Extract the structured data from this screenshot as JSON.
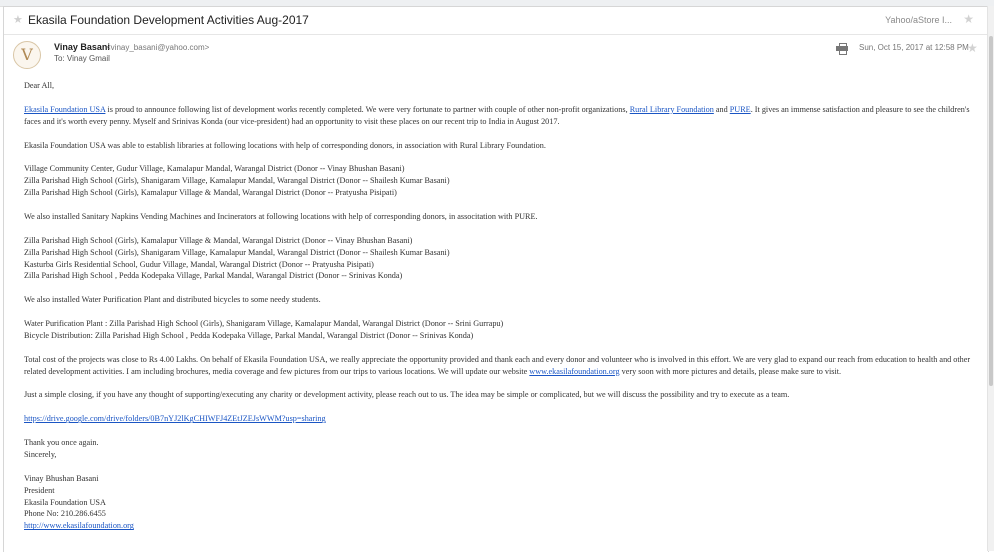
{
  "email": {
    "subject": "Ekasila Foundation Development Activities Aug-2017",
    "folder": "Yahoo/aStore I...",
    "sender_name": "Vinay Basani",
    "sender_email": "<vinay_basani@yahoo.com>",
    "to_line": "To: Vinay Gmail",
    "date": "Sun, Oct 15, 2017 at 12:58 PM",
    "avatar_letter": "V"
  },
  "body": {
    "greeting": "Dear All,",
    "p1_link1": "Ekasila Foundation USA",
    "p1_text1": " is proud to announce following list of development works recently completed. We were very fortunate to partner with couple of other non-profit organizations, ",
    "p1_link2": "Rural Library Foundation",
    "p1_text2": " and ",
    "p1_link3": "PURE",
    "p1_text3": ". It gives an immense satisfaction and pleasure to see the children's faces and it's worth every penny. Myself and Srinivas Konda (our vice-president) had an opportunity to visit these places on our recent trip to India in August 2017.",
    "p2": "Ekasila Foundation USA was able to establish libraries at following locations with help of corresponding donors, in association with Rural Library Foundation.",
    "libraries": [
      "Village Community Center, Gudur Village, Kamalapur Mandal, Warangal District (Donor -- Vinay Bhushan Basani)",
      "Zilla Parishad High School (Girls), Shanigaram Village, Kamalapur Mandal, Warangal District (Donor -- Shailesh Kumar Basani)",
      "Zilla Parishad High School (Girls), Kamalapur Village & Mandal, Warangal District (Donor -- Pratyusha Pisipati)"
    ],
    "p3": "We also installed Sanitary Napkins Vending Machines and Incinerators at following locations with help of corresponding donors, in associtation with PURE.",
    "napkins": [
      "Zilla Parishad High School (Girls), Kamalapur Village & Mandal, Warangal District (Donor -- Vinay Bhushan Basani)",
      "Zilla Parishad High School (Girls), Shanigaram Village, Kamalapur Mandal, Warangal District (Donor -- Shailesh Kumar Basani)",
      "Kasturba Girls Residential School,  Gudur Village, Mandal, Warangal District (Donor -- Pratyusha Pisipati)",
      "Zilla Parishad High School , Pedda Kodepaka Village, Parkal Mandal, Warangal District (Donor -- Srinivas Konda)"
    ],
    "p4": "We also installed Water Purification Plant and distributed bicycles to some needy students.",
    "water": [
      "Water Purification Plant : Zilla Parishad High School (Girls), Shanigaram Village, Kamalapur Mandal, Warangal District (Donor -- Srini Gurrapu)",
      "Bicycle Distribution: Zilla Parishad High School , Pedda Kodepaka Village, Parkal Mandal, Warangal District (Donor -- Srinivas Konda)"
    ],
    "p5_text1": "Total cost of the projects was close to Rs 4.00 Lakhs. On behalf of Ekasila Foundation USA, we really appreciate the opportunity provided and thank each and every donor and volunteer who is involved in this effort. We are very glad to expand our reach from education to health and other related development activities. I am including brochures, media coverage and few pictures from our trips to various locations. We will update our website ",
    "p5_link": "www.ekasilafoundation.org",
    "p5_text2": " very soon with more pictures and details, please make sure to visit.",
    "p6": "Just a simple closing, if you have any thought of supporting/executing any charity or development activity, please reach out to us. The idea may be simple or complicated, but we will discuss the possibility and try to execute as a team.",
    "drive_link": "https://drive.google.com/drive/folders/0B7nYJ2lKgCHIWFJ4ZEtJZEJsWWM?usp=sharing",
    "thanks": "Thank you once again.",
    "sincerely": "Sincerely,",
    "sig_name": "Vinay Bhushan Basani",
    "sig_title": "President",
    "sig_org": "Ekasila Foundation USA",
    "sig_phone": "Phone No: 210.286.6455",
    "sig_link": "http://www.ekasilafoundation.org"
  }
}
